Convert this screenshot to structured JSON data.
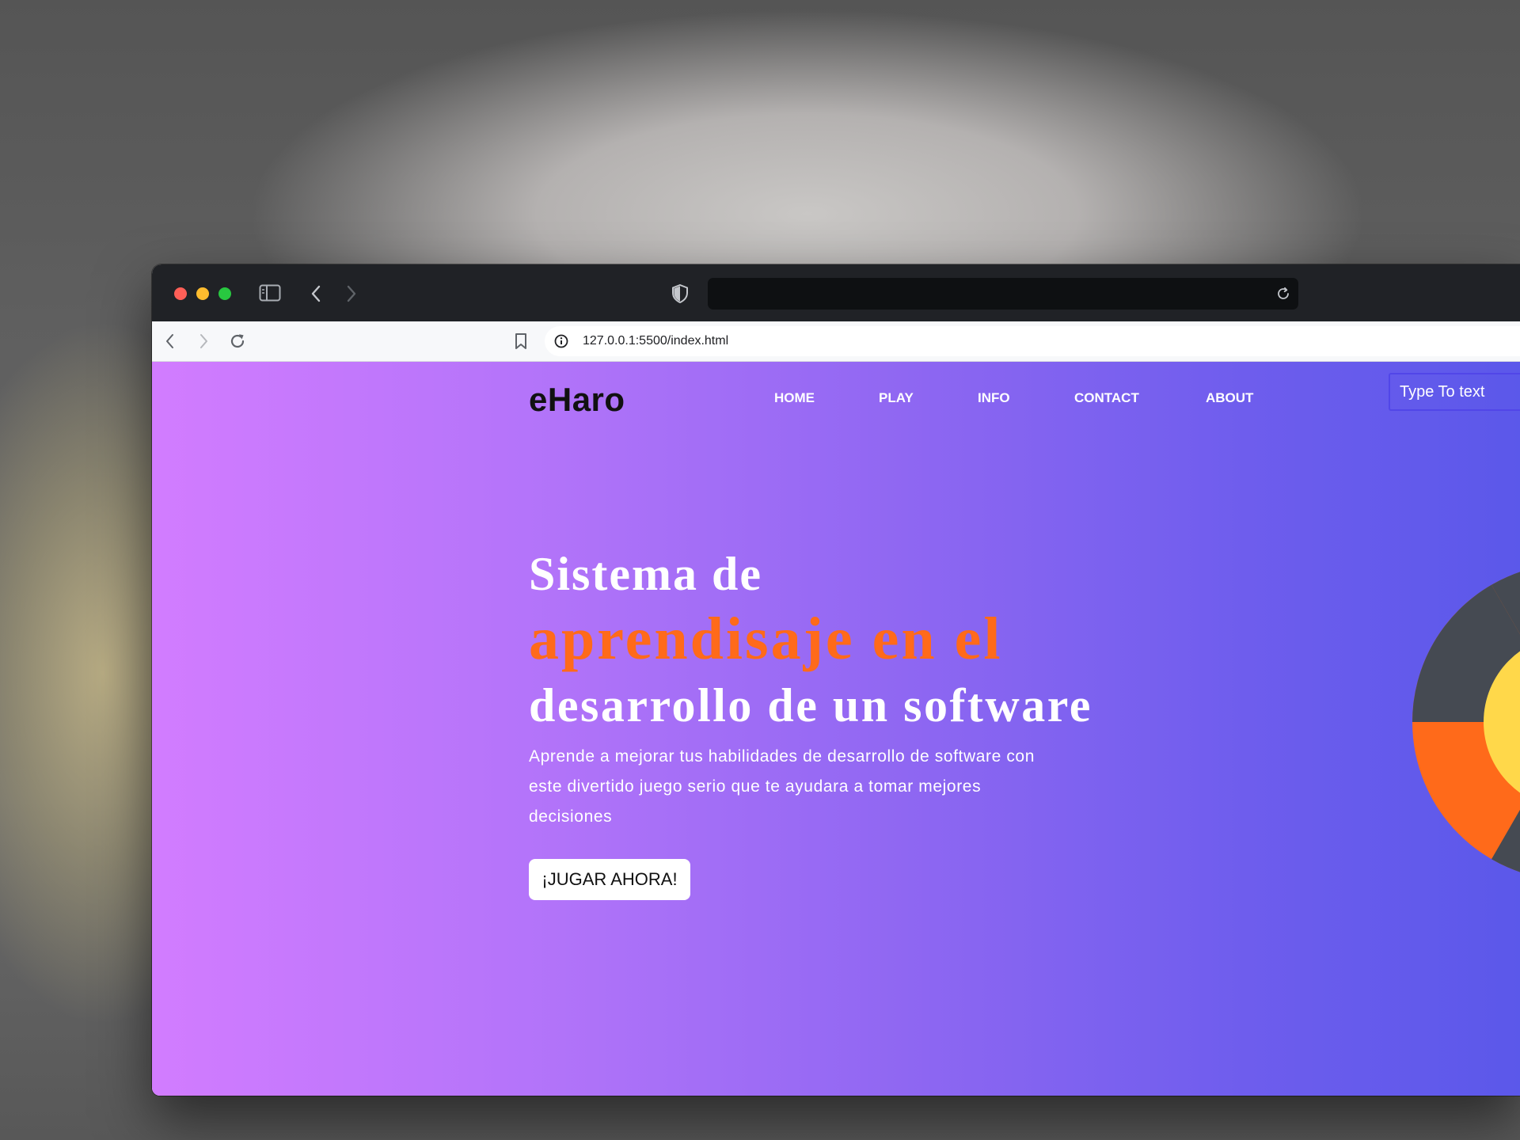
{
  "browser": {
    "url": "127.0.0.1:5500/index.html",
    "icons": [
      "sidebar-icon",
      "back-icon",
      "forward-icon",
      "shield-icon",
      "reload-icon",
      "bookmark-icon",
      "info-icon"
    ]
  },
  "page": {
    "logo": "eHaro",
    "nav": {
      "home": "HOME",
      "play": "PLAY",
      "info": "INFO",
      "contact": "CONTACT",
      "about": "ABOUT"
    },
    "search_placeholder": "Type To text",
    "hero": {
      "line1": "Sistema de",
      "line2": "aprendisaje en el",
      "line3": "desarrollo de un software",
      "description": "Aprende a mejorar tus habilidades de desarrollo de software con este divertido juego serio que te ayudara a tomar mejores decisiones",
      "cta": "¡JUGAR AHORA!"
    }
  },
  "colors": {
    "accent_orange": "#ff6a1a",
    "gradient_start": "#d27cff",
    "gradient_end": "#5b58ea",
    "search_border": "#5146e8",
    "wheel_dark": "#454a52",
    "wheel_yellow": "#ffd84a"
  }
}
